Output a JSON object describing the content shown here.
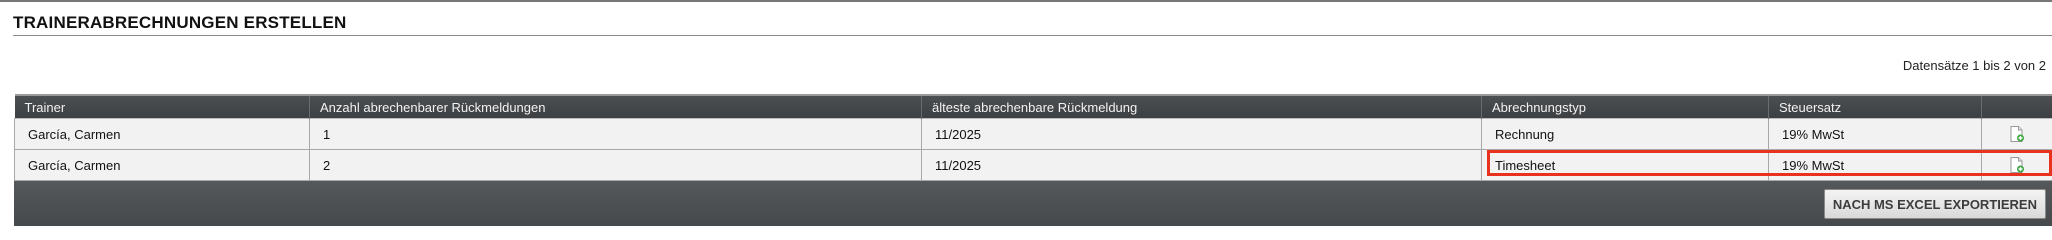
{
  "page": {
    "title": "TRAINERABRECHNUNGEN ERSTELLEN",
    "record_count": "Datensätze 1 bis 2 von 2"
  },
  "table": {
    "columns": [
      "Trainer",
      "Anzahl abrechenbarer Rückmeldungen",
      "älteste abrechenbare Rückmeldung",
      "Abrechnungstyp",
      "Steuersatz",
      ""
    ],
    "rows": [
      {
        "trainer": "García, Carmen",
        "count": "1",
        "oldest": "11/2025",
        "type": "Rechnung",
        "tax": "19% MwSt",
        "action_icon": "add-document-icon",
        "highlighted": false
      },
      {
        "trainer": "García, Carmen",
        "count": "2",
        "oldest": "11/2025",
        "type": "Timesheet",
        "tax": "19% MwSt",
        "action_icon": "add-document-icon",
        "highlighted": true
      }
    ]
  },
  "footer": {
    "export_label": "NACH MS EXCEL EXPORTIEREN"
  },
  "colors": {
    "header_bg": "#45484b",
    "highlight_border": "#e8321e",
    "add_badge": "#3aa640"
  }
}
